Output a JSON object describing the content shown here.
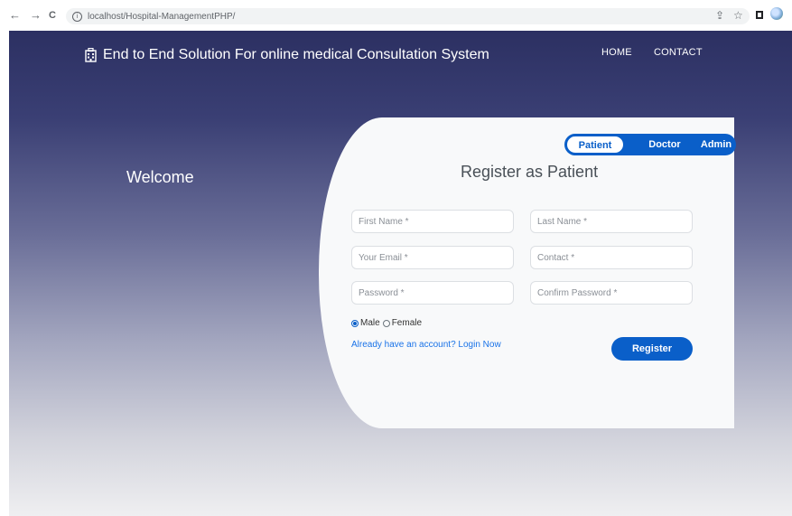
{
  "browser": {
    "back_glyph": "←",
    "forward_glyph": "→",
    "reload_glyph": "C",
    "url": "localhost/Hospital-ManagementPHP/",
    "share_glyph": "⇪",
    "star_glyph": "☆"
  },
  "header": {
    "brand_title": "End to End Solution For online medical Consultation System",
    "nav": [
      {
        "label": "HOME"
      },
      {
        "label": "CONTACT"
      }
    ]
  },
  "welcome": "Welcome",
  "role_tabs": [
    {
      "label": "Patient",
      "active": true
    },
    {
      "label": "Doctor",
      "active": false
    },
    {
      "label": "Admin",
      "active": false
    }
  ],
  "form": {
    "title": "Register as Patient",
    "first_name_placeholder": "First Name *",
    "last_name_placeholder": "Last Name *",
    "email_placeholder": "Your Email *",
    "contact_placeholder": "Contact *",
    "password_placeholder": "Password *",
    "confirm_password_placeholder": "Confirm Password *",
    "gender_options": [
      {
        "label": "Male",
        "checked": true
      },
      {
        "label": "Female",
        "checked": false
      }
    ],
    "login_link": "Already have an account? Login Now",
    "submit_label": "Register"
  },
  "colors": {
    "primary": "#0a5fc9",
    "header_dark": "#2c3062"
  },
  "icons": {
    "brand": "hospital-icon",
    "info": "info-icon",
    "sidebar": "sidebar-icon",
    "profile": "profile-avatar-icon"
  }
}
